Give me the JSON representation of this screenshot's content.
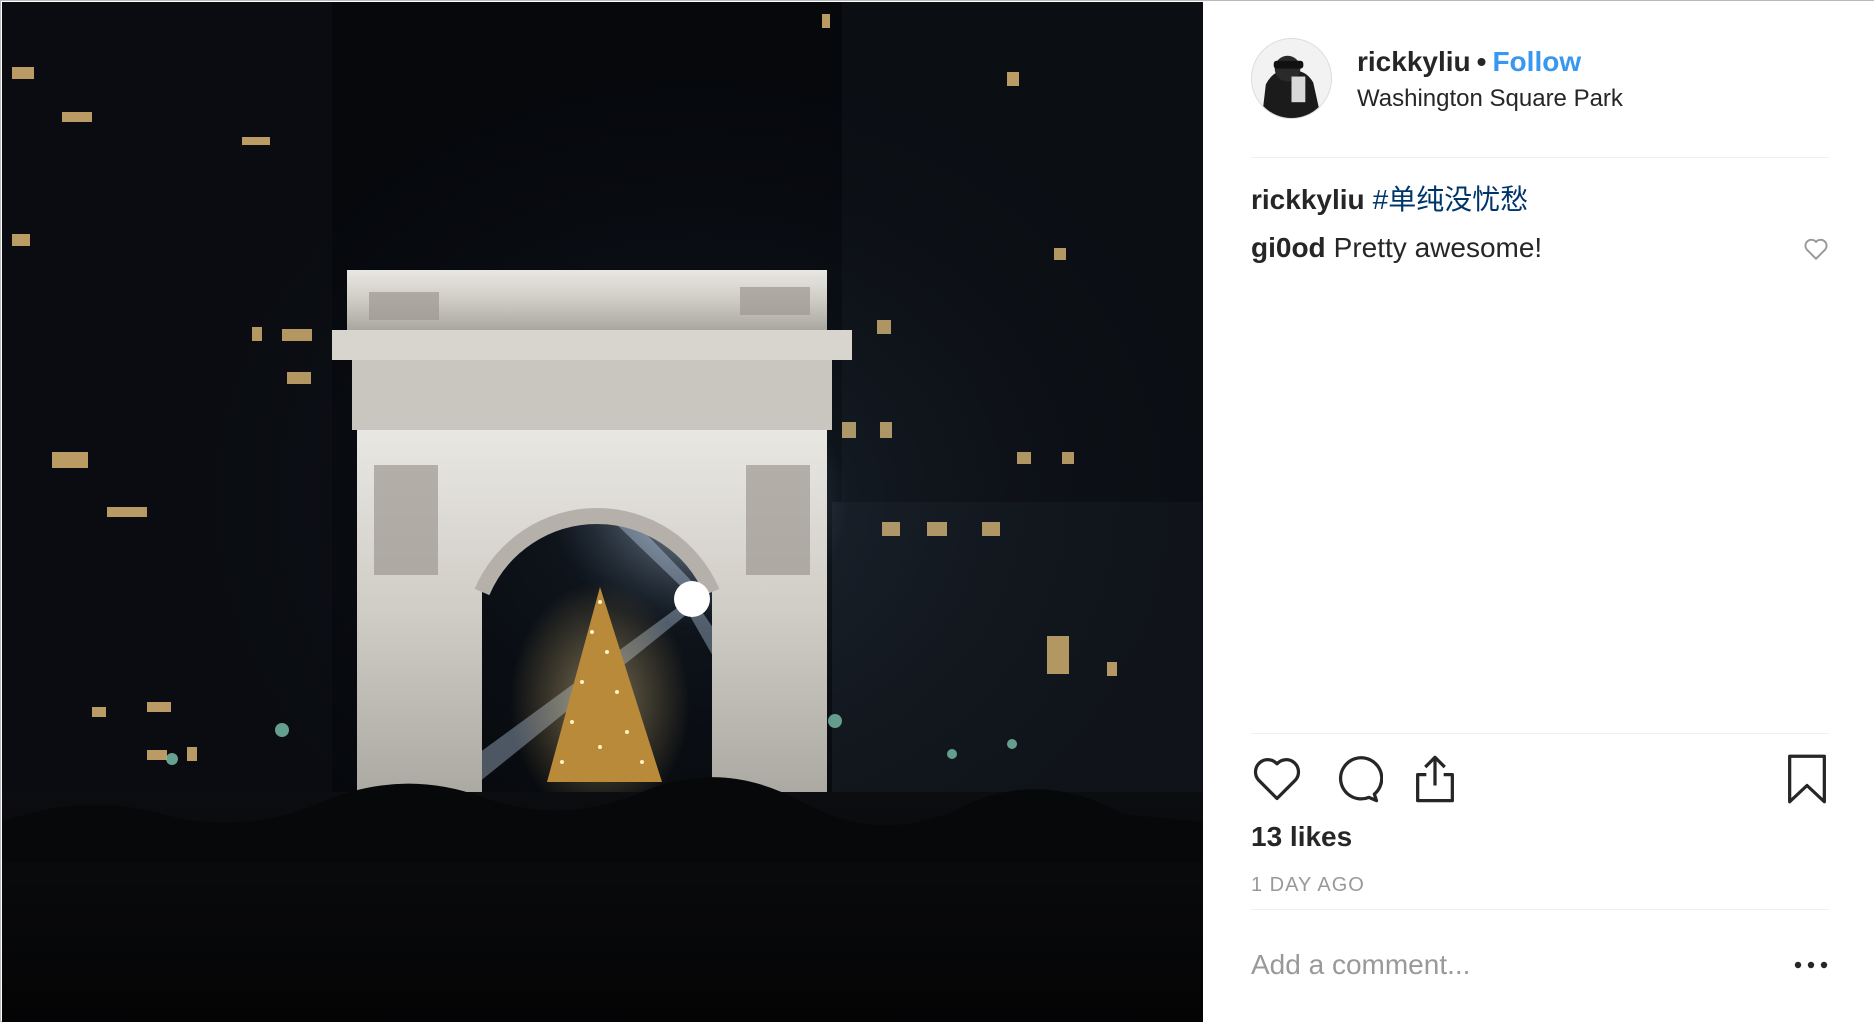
{
  "post": {
    "photo_icon": "washington-square-arch-photo",
    "author": {
      "username": "rickkyliu",
      "separator": "•",
      "follow_label": "Follow",
      "location": "Washington Square Park"
    },
    "caption": {
      "author": "rickkyliu",
      "hashtag": "#单纯没忧愁"
    },
    "comments": [
      {
        "author": "gi0od",
        "text": "Pretty awesome!"
      }
    ],
    "actions": {
      "like_icon": "heart-icon",
      "comment_icon": "comment-bubble-icon",
      "share_icon": "share-upload-icon",
      "save_icon": "bookmark-icon"
    },
    "likes_text": "13 likes",
    "timestamp": "1 DAY AGO",
    "add_comment_placeholder": "Add a comment...",
    "more_icon": "more-options-icon"
  },
  "colors": {
    "follow": "#3897f0",
    "hashtag": "#003569",
    "muted": "#999999",
    "text": "#262626"
  }
}
